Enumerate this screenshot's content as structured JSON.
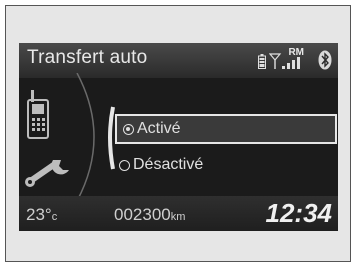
{
  "screen": {
    "title": "Transfert auto",
    "status": {
      "roaming_label": "RM",
      "signal_icon": "signal-strength-icon",
      "battery_icon": "phone-battery-icon",
      "bluetooth_icon": "bluetooth-icon"
    },
    "options": [
      {
        "label": "Activé",
        "selected": true
      },
      {
        "label": "Désactivé",
        "selected": false
      }
    ],
    "left_icons": [
      "phone-icon",
      "wrench-icon"
    ],
    "footer": {
      "temperature_value": "23°",
      "temperature_unit": "c",
      "odometer_value": "002300",
      "odometer_unit": "km",
      "clock": "12:34"
    }
  }
}
